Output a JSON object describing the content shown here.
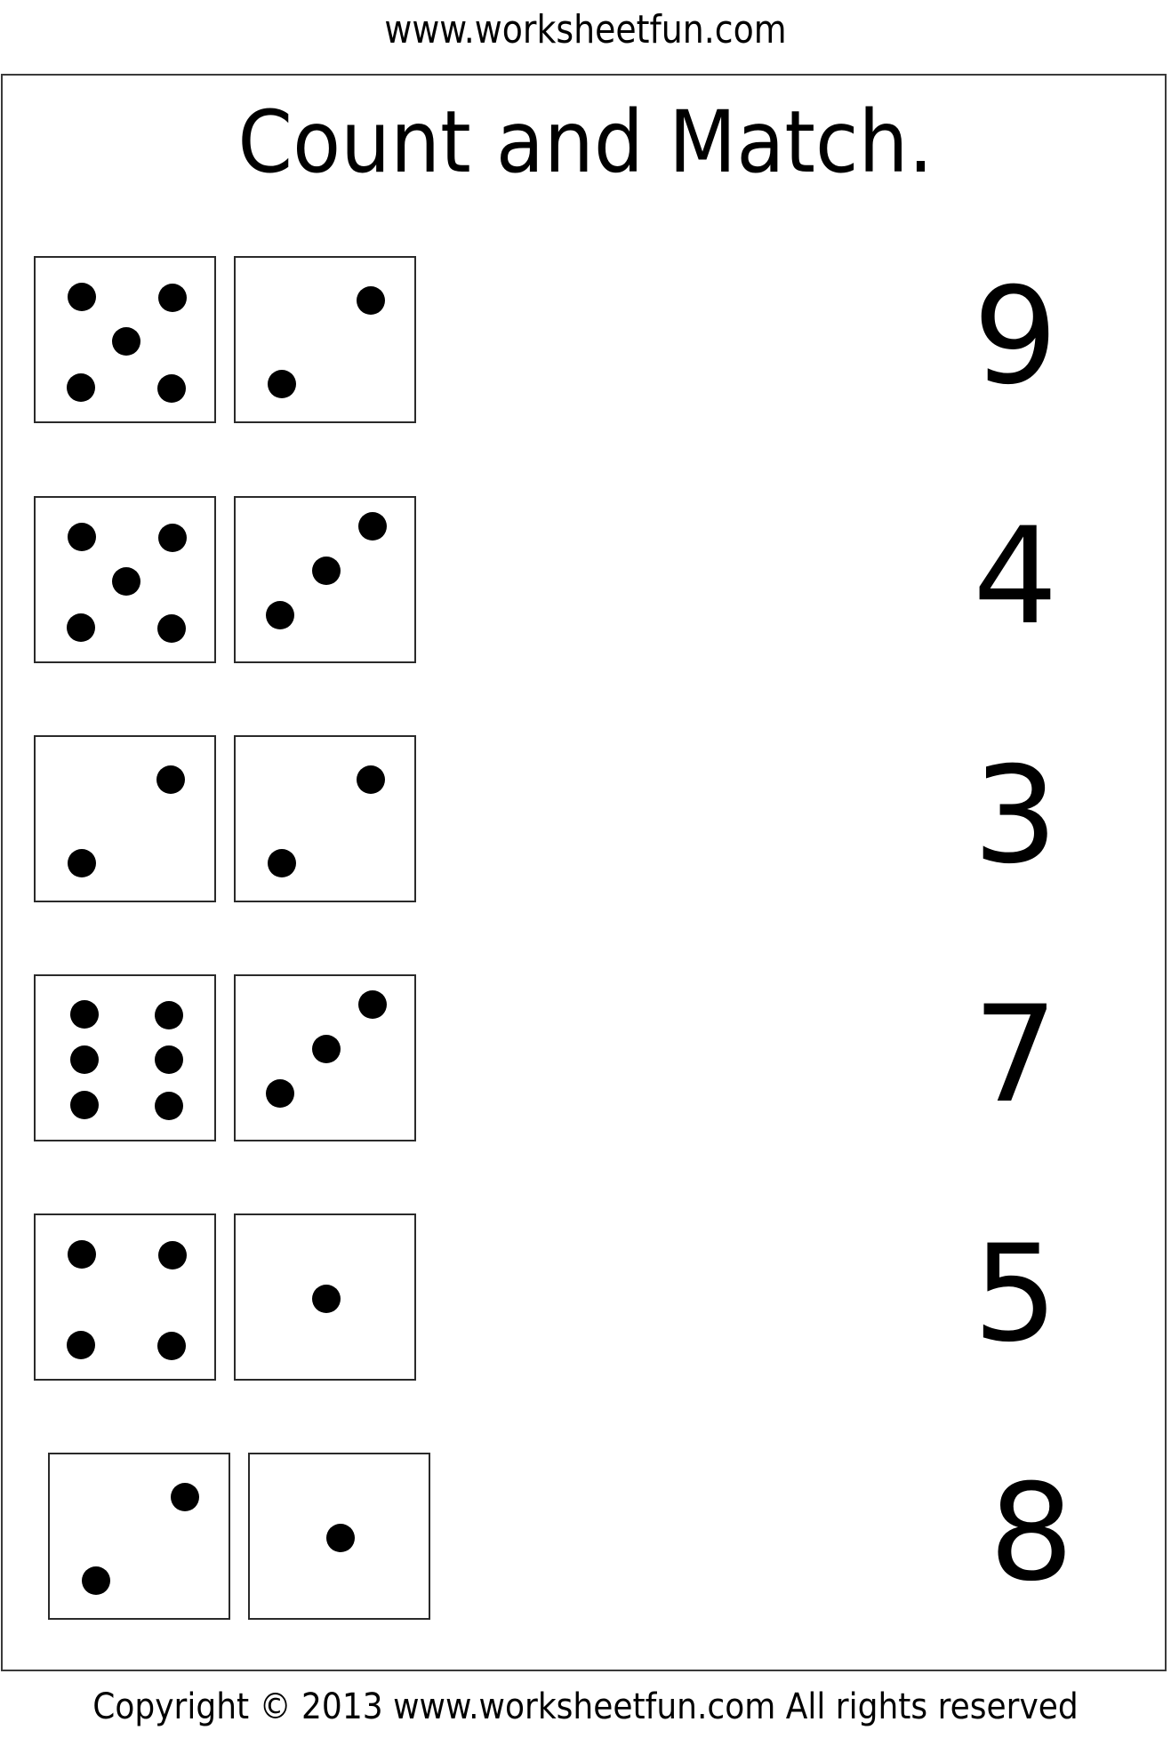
{
  "header": {
    "site": "www.worksheetfun.com"
  },
  "worksheet": {
    "title": "Count and Match.",
    "rows": [
      {
        "left_die": 5,
        "right_die": 2,
        "numeral": "9"
      },
      {
        "left_die": 5,
        "right_die": 3,
        "numeral": "4"
      },
      {
        "left_die": 2,
        "right_die": 2,
        "numeral": "3"
      },
      {
        "left_die": 6,
        "right_die": 3,
        "numeral": "7"
      },
      {
        "left_die": 4,
        "right_die": 1,
        "numeral": "5"
      },
      {
        "left_die": 2,
        "right_die": 1,
        "numeral": "8"
      }
    ]
  },
  "footer": {
    "copyright": "Copyright © 2013 www.worksheetfun.com All rights reserved"
  }
}
